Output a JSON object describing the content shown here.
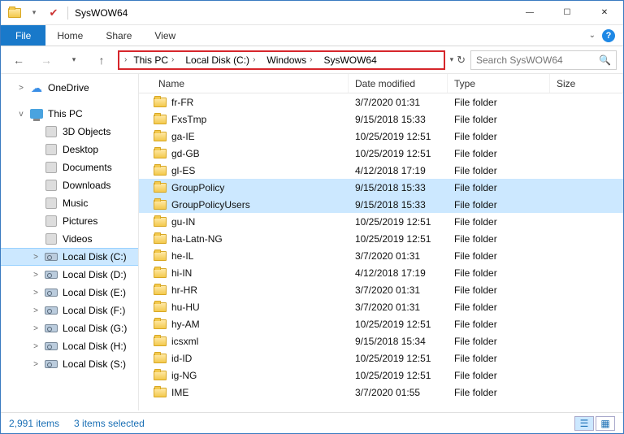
{
  "window": {
    "title": "SysWOW64"
  },
  "ribbon": {
    "file": "File",
    "tabs": [
      "Home",
      "Share",
      "View"
    ]
  },
  "breadcrumb": [
    "This PC",
    "Local Disk (C:)",
    "Windows",
    "SysWOW64"
  ],
  "search": {
    "placeholder": "Search SysWOW64"
  },
  "navItems": [
    {
      "label": "OneDrive",
      "icon": "cloud",
      "indent": false,
      "twisty": ">"
    },
    {
      "spacer": true
    },
    {
      "label": "This PC",
      "icon": "thispc",
      "indent": false,
      "twisty": "v"
    },
    {
      "label": "3D Objects",
      "icon": "generic",
      "indent": true
    },
    {
      "label": "Desktop",
      "icon": "generic",
      "indent": true
    },
    {
      "label": "Documents",
      "icon": "generic",
      "indent": true
    },
    {
      "label": "Downloads",
      "icon": "generic",
      "indent": true
    },
    {
      "label": "Music",
      "icon": "generic",
      "indent": true
    },
    {
      "label": "Pictures",
      "icon": "generic",
      "indent": true
    },
    {
      "label": "Videos",
      "icon": "generic",
      "indent": true
    },
    {
      "label": "Local Disk (C:)",
      "icon": "disk",
      "indent": true,
      "twisty": ">",
      "selected": true
    },
    {
      "label": "Local Disk (D:)",
      "icon": "disk",
      "indent": true,
      "twisty": ">"
    },
    {
      "label": "Local Disk (E:)",
      "icon": "disk",
      "indent": true,
      "twisty": ">"
    },
    {
      "label": "Local Disk (F:)",
      "icon": "disk",
      "indent": true,
      "twisty": ">"
    },
    {
      "label": "Local Disk (G:)",
      "icon": "disk",
      "indent": true,
      "twisty": ">"
    },
    {
      "label": "Local Disk (H:)",
      "icon": "disk",
      "indent": true,
      "twisty": ">"
    },
    {
      "label": "Local Disk (S:)",
      "icon": "disk",
      "indent": true,
      "twisty": ">"
    }
  ],
  "columns": {
    "name": "Name",
    "date": "Date modified",
    "type": "Type",
    "size": "Size"
  },
  "rows": [
    {
      "name": "fr-FR",
      "date": "3/7/2020 01:31",
      "type": "File folder"
    },
    {
      "name": "FxsTmp",
      "date": "9/15/2018 15:33",
      "type": "File folder"
    },
    {
      "name": "ga-IE",
      "date": "10/25/2019 12:51",
      "type": "File folder"
    },
    {
      "name": "gd-GB",
      "date": "10/25/2019 12:51",
      "type": "File folder"
    },
    {
      "name": "gl-ES",
      "date": "4/12/2018 17:19",
      "type": "File folder"
    },
    {
      "name": "GroupPolicy",
      "date": "9/15/2018 15:33",
      "type": "File folder",
      "selected": true
    },
    {
      "name": "GroupPolicyUsers",
      "date": "9/15/2018 15:33",
      "type": "File folder",
      "selected": true
    },
    {
      "name": "gu-IN",
      "date": "10/25/2019 12:51",
      "type": "File folder"
    },
    {
      "name": "ha-Latn-NG",
      "date": "10/25/2019 12:51",
      "type": "File folder"
    },
    {
      "name": "he-IL",
      "date": "3/7/2020 01:31",
      "type": "File folder"
    },
    {
      "name": "hi-IN",
      "date": "4/12/2018 17:19",
      "type": "File folder"
    },
    {
      "name": "hr-HR",
      "date": "3/7/2020 01:31",
      "type": "File folder"
    },
    {
      "name": "hu-HU",
      "date": "3/7/2020 01:31",
      "type": "File folder"
    },
    {
      "name": "hy-AM",
      "date": "10/25/2019 12:51",
      "type": "File folder"
    },
    {
      "name": "icsxml",
      "date": "9/15/2018 15:34",
      "type": "File folder"
    },
    {
      "name": "id-ID",
      "date": "10/25/2019 12:51",
      "type": "File folder"
    },
    {
      "name": "ig-NG",
      "date": "10/25/2019 12:51",
      "type": "File folder"
    },
    {
      "name": "IME",
      "date": "3/7/2020 01:55",
      "type": "File folder"
    }
  ],
  "status": {
    "count": "2,991 items",
    "selection": "3 items selected"
  }
}
